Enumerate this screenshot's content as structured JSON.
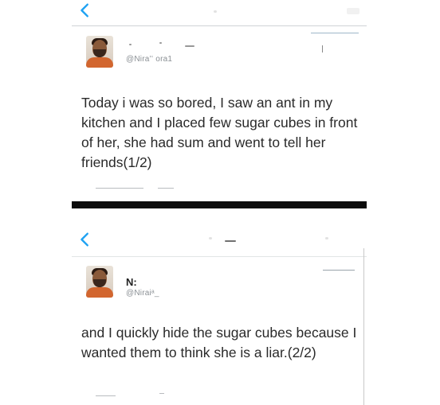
{
  "posts": [
    {
      "name": "",
      "handle": "@Niraʻʻ  ora1",
      "text": "Today i was so bored, I saw an ant in my kitchen and I placed few sugar cubes in front of her, she had sum and went to tell her friends(1/2)"
    },
    {
      "name": "N:",
      "handle": "@Niraiᵃ_",
      "text": "and I quickly hide the sugar cubes because I wanted them to think she is a liar.(2/2)"
    }
  ],
  "icons": {
    "back": "chevron-left-icon",
    "avatar": "profile-photo"
  },
  "colors": {
    "accent": "#1da1f2",
    "divider": "#0c0c0c",
    "handle": "#8a8f94"
  }
}
